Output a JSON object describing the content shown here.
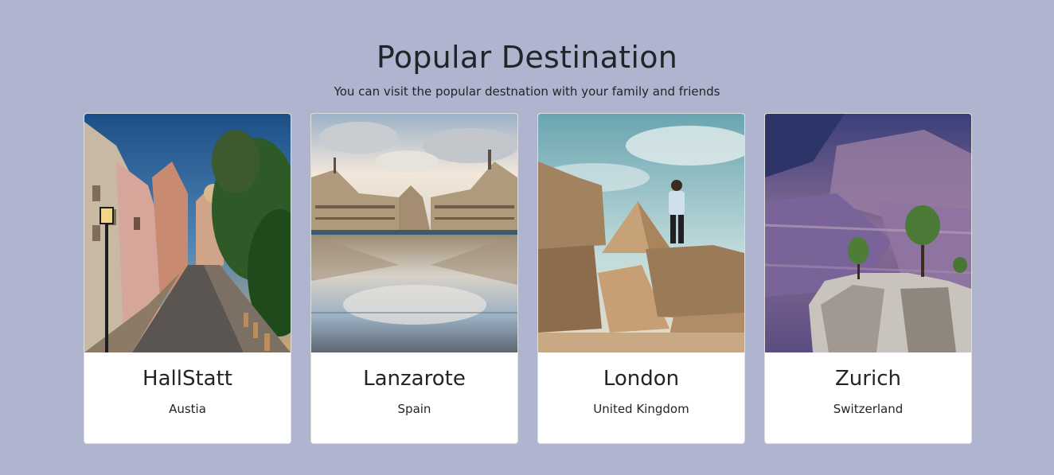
{
  "header": {
    "title": "Popular Destination",
    "subtitle": "You can visit the popular destnation with your family and friends"
  },
  "destinations": [
    {
      "name": "HallStatt",
      "country": "Austia",
      "image": "street-photo"
    },
    {
      "name": "Lanzarote",
      "country": "Spain",
      "image": "reflecting-plaza-photo"
    },
    {
      "name": "London",
      "country": "United Kingdom",
      "image": "pyramid-rocks-photo"
    },
    {
      "name": "Zurich",
      "country": "Switzerland",
      "image": "canyon-cliff-photo"
    }
  ],
  "colors": {
    "page_background": "#afb5ce",
    "card_background": "#ffffff",
    "text": "#212529"
  }
}
